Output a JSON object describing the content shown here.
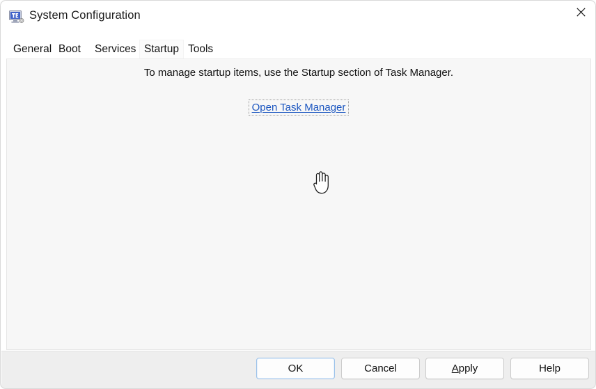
{
  "window": {
    "title": "System Configuration",
    "icon": "system-configuration-icon",
    "close_label": "✕"
  },
  "tabs": [
    {
      "label": "General",
      "selected": false
    },
    {
      "label": "Boot",
      "selected": false
    },
    {
      "label": "Services",
      "selected": false
    },
    {
      "label": "Startup",
      "selected": true
    },
    {
      "label": "Tools",
      "selected": false
    }
  ],
  "content": {
    "info_text": "To manage startup items, use the Startup section of Task Manager.",
    "link_label": "Open Task Manager"
  },
  "cursor": {
    "type": "hand-pointer-cursor"
  },
  "buttons": [
    {
      "label": "OK",
      "default": true
    },
    {
      "label": "Cancel",
      "default": false
    },
    {
      "label": "Apply",
      "accesskey": "A",
      "default": false
    },
    {
      "label": "Help",
      "default": false
    }
  ],
  "colors": {
    "link": "#1a55c0",
    "default_button_border": "#9cc2ea",
    "panel_bg": "#f7f7f7",
    "footer_bg": "#eeeeee"
  }
}
